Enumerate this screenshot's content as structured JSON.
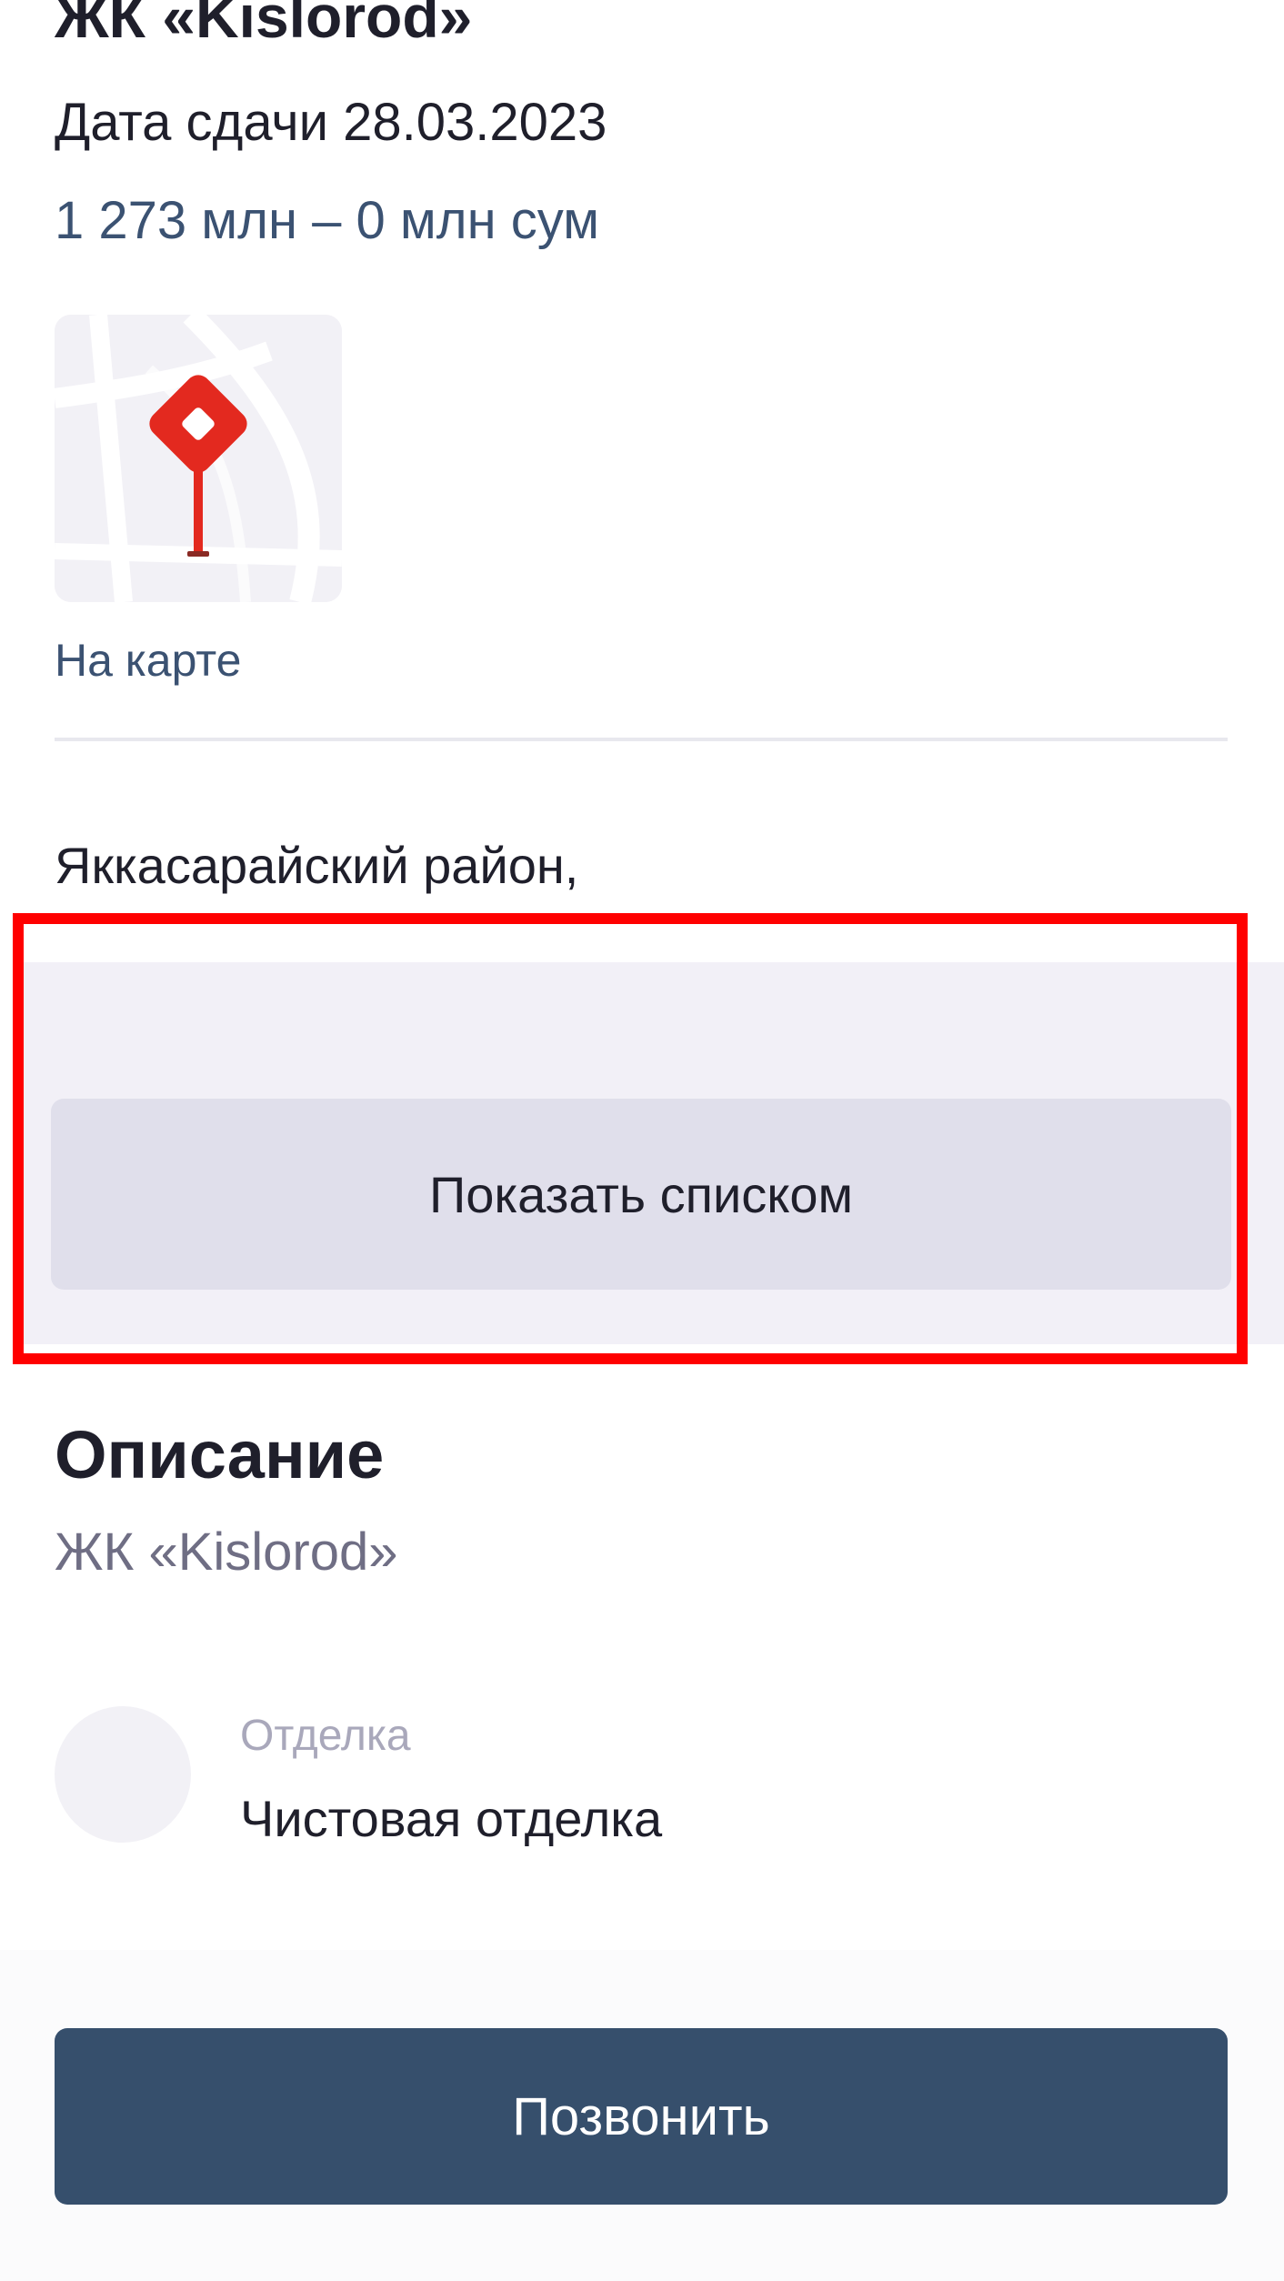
{
  "complex": {
    "title": "ЖК «Kislorod»",
    "delivery_date": "Дата сдачи 28.03.2023",
    "price_range": "1 273 млн – 0 млн сум"
  },
  "map": {
    "thumbnail_icon": "map-pin-icon",
    "link_label": "На карте"
  },
  "location": {
    "address": "Яккасарайский район,"
  },
  "list_section": {
    "show_list_label": "Показать списком"
  },
  "description": {
    "heading": "Описание",
    "text": "ЖК «Kislorod»"
  },
  "features": [
    {
      "label": "Отделка",
      "value": "Чистовая отделка"
    }
  ],
  "actions": {
    "call_label": "Позвонить"
  },
  "colors": {
    "accent_text": "#3b5272",
    "primary_button": "#364f6c",
    "map_pin": "#e3291f",
    "highlight_border": "#ff0000"
  }
}
